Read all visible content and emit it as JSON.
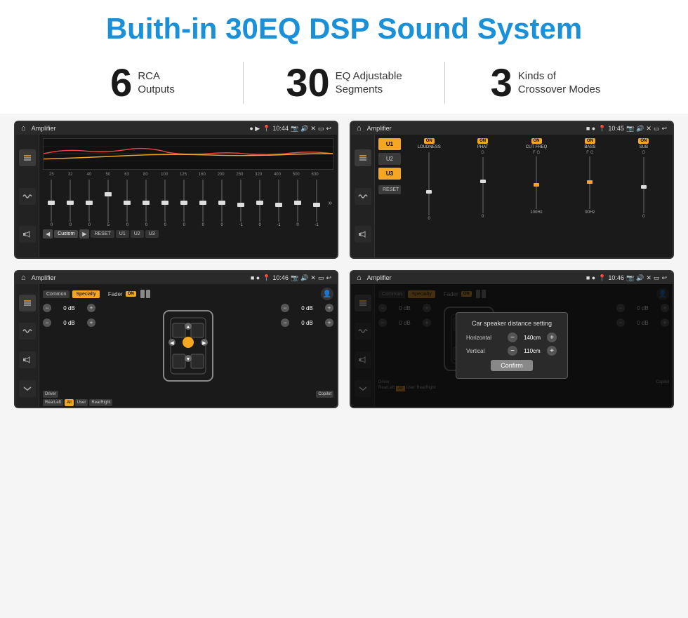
{
  "header": {
    "title": "Buith-in 30EQ DSP Sound System"
  },
  "stats": [
    {
      "number": "6",
      "label": "RCA\nOutputs"
    },
    {
      "number": "30",
      "label": "EQ Adjustable\nSegments"
    },
    {
      "number": "3",
      "label": "Kinds of\nCrossover Modes"
    }
  ],
  "screens": [
    {
      "id": "screen1",
      "status_bar": {
        "title": "Amplifier",
        "time": "10:44"
      }
    },
    {
      "id": "screen2",
      "status_bar": {
        "title": "Amplifier",
        "time": "10:45"
      }
    },
    {
      "id": "screen3",
      "status_bar": {
        "title": "Amplifier",
        "time": "10:46"
      }
    },
    {
      "id": "screen4",
      "status_bar": {
        "title": "Amplifier",
        "time": "10:46"
      }
    }
  ],
  "eq": {
    "frequencies": [
      "25",
      "32",
      "40",
      "50",
      "63",
      "80",
      "100",
      "125",
      "160",
      "200",
      "250",
      "320",
      "400",
      "500",
      "630"
    ],
    "values": [
      "0",
      "0",
      "0",
      "5",
      "0",
      "0",
      "0",
      "0",
      "0",
      "0",
      "-1",
      "0",
      "-1"
    ],
    "presets": [
      "Custom",
      "RESET",
      "U1",
      "U2",
      "U3"
    ]
  },
  "amp2": {
    "presets": [
      "U1",
      "U2",
      "U3"
    ],
    "modules": [
      "LOUDNESS",
      "PHAT",
      "CUT FREQ",
      "BASS",
      "SUB"
    ],
    "toggles": [
      "ON",
      "ON",
      "ON",
      "ON",
      "ON"
    ]
  },
  "fader": {
    "tabs": [
      "Common",
      "Specialty"
    ],
    "label": "Fader",
    "on_label": "ON",
    "channels": [
      "Driver",
      "Copilot",
      "RearLeft",
      "RearRight",
      "All",
      "User"
    ],
    "db_values": [
      "0 dB",
      "0 dB",
      "0 dB",
      "0 dB"
    ]
  },
  "modal": {
    "title": "Car speaker distance setting",
    "horizontal_label": "Horizontal",
    "horizontal_value": "140cm",
    "vertical_label": "Vertical",
    "vertical_value": "110cm",
    "confirm_label": "Confirm"
  }
}
